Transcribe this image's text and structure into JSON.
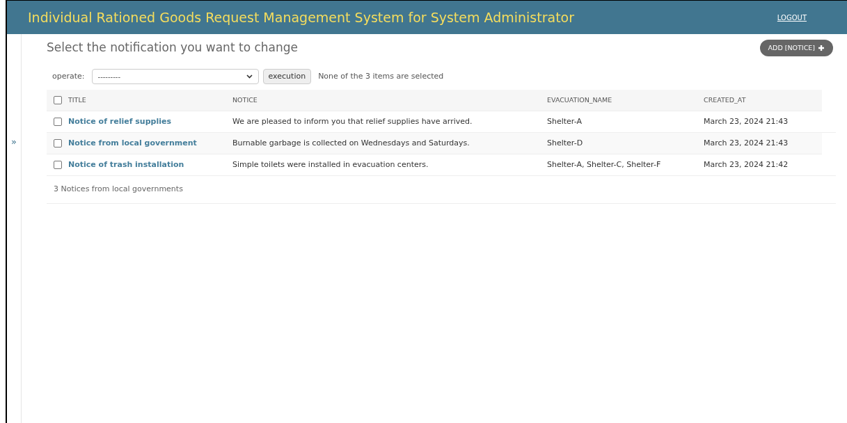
{
  "header": {
    "title": "Individual Rationed Goods Request Management System for System Administrator",
    "logout": "LOGOUT"
  },
  "page_title": "Select the notification you want to change",
  "add_button": "ADD [NOTICE]",
  "actions": {
    "label": "operate:",
    "select_value": "---------",
    "button": "execution",
    "status": "None of the 3 items are selected"
  },
  "table": {
    "select_all_checked": false,
    "columns": [
      "TITLE",
      "NOTICE",
      "EVACUATION_NAME",
      "CREATED_AT"
    ],
    "rows": [
      {
        "checked": false,
        "title": "Notice of relief supplies",
        "notice": "We are pleased to inform you that relief supplies have arrived.",
        "evacuation_name": "Shelter-A",
        "created_at": "March 23, 2024 21:43"
      },
      {
        "checked": false,
        "title": "Notice from local government",
        "notice": "Burnable garbage is collected on Wednesdays and Saturdays.",
        "evacuation_name": "Shelter-D",
        "created_at": "March 23, 2024 21:43"
      },
      {
        "checked": false,
        "title": "Notice of trash installation",
        "notice": "Simple toilets were installed in evacuation centers.",
        "evacuation_name": "Shelter-A, Shelter-C, Shelter-F",
        "created_at": "March 23, 2024 21:42"
      }
    ]
  },
  "footer_count": "3 Notices from local governments",
  "sidebar_toggle": "»"
}
